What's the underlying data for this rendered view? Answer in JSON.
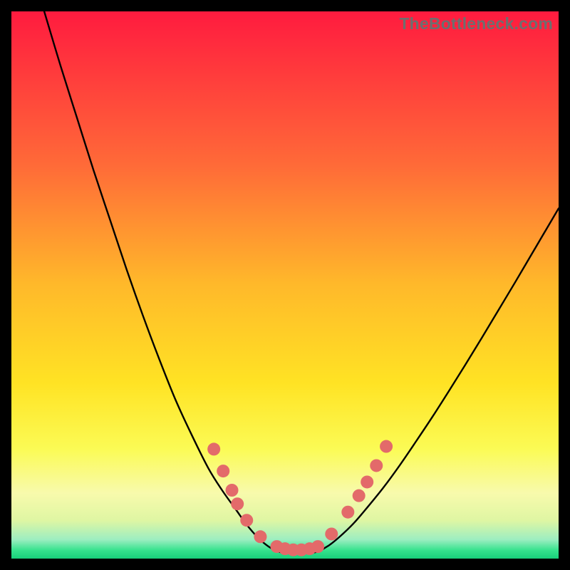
{
  "watermark": "TheBottleneck.com",
  "colors": {
    "page_bg": "#000000",
    "curve": "#000000",
    "dot_fill": "#e36a6a",
    "dot_stroke": "#c94f4f",
    "gradient_stops": [
      {
        "offset": 0.0,
        "color": "#ff1b3f"
      },
      {
        "offset": 0.28,
        "color": "#ff6a38"
      },
      {
        "offset": 0.5,
        "color": "#ffb92a"
      },
      {
        "offset": 0.68,
        "color": "#ffe324"
      },
      {
        "offset": 0.8,
        "color": "#fbfb55"
      },
      {
        "offset": 0.88,
        "color": "#f8faac"
      },
      {
        "offset": 0.93,
        "color": "#dff6a3"
      },
      {
        "offset": 0.965,
        "color": "#9deec1"
      },
      {
        "offset": 0.985,
        "color": "#35e28d"
      },
      {
        "offset": 1.0,
        "color": "#18cf7a"
      }
    ]
  },
  "chart_data": {
    "type": "line",
    "title": "",
    "xlabel": "",
    "ylabel": "",
    "xlim": [
      0,
      100
    ],
    "ylim": [
      0,
      100
    ],
    "series": [
      {
        "name": "left-branch",
        "x": [
          6,
          9,
          12,
          15,
          18,
          21,
          24,
          27,
          30,
          33,
          36,
          38.5,
          41,
          43,
          45,
          47,
          49
        ],
        "y": [
          100,
          90,
          80.5,
          71,
          62,
          53,
          44.5,
          36.5,
          29,
          22.5,
          16.5,
          12.5,
          9,
          6.2,
          3.9,
          2.2,
          1.2
        ]
      },
      {
        "name": "valley-floor",
        "x": [
          49,
          51,
          53,
          55,
          56
        ],
        "y": [
          1.2,
          1.0,
          1.0,
          1.1,
          1.3
        ]
      },
      {
        "name": "right-branch",
        "x": [
          56,
          58,
          60,
          62.5,
          65,
          68,
          71,
          74,
          77,
          80,
          83,
          86,
          89,
          92,
          95,
          98,
          100
        ],
        "y": [
          1.3,
          2.4,
          4.0,
          6.4,
          9.3,
          13.0,
          17.1,
          21.5,
          26.0,
          30.7,
          35.5,
          40.4,
          45.4,
          50.4,
          55.5,
          60.6,
          64.0
        ]
      }
    ],
    "markers": [
      {
        "x": 37.0,
        "y": 20.0
      },
      {
        "x": 38.7,
        "y": 16.0
      },
      {
        "x": 40.3,
        "y": 12.5
      },
      {
        "x": 41.3,
        "y": 10.0
      },
      {
        "x": 43.0,
        "y": 7.0
      },
      {
        "x": 45.5,
        "y": 4.0
      },
      {
        "x": 48.5,
        "y": 2.2
      },
      {
        "x": 50.0,
        "y": 1.8
      },
      {
        "x": 51.5,
        "y": 1.6
      },
      {
        "x": 53.0,
        "y": 1.6
      },
      {
        "x": 54.5,
        "y": 1.8
      },
      {
        "x": 56.0,
        "y": 2.2
      },
      {
        "x": 58.5,
        "y": 4.5
      },
      {
        "x": 61.5,
        "y": 8.5
      },
      {
        "x": 63.5,
        "y": 11.5
      },
      {
        "x": 65.0,
        "y": 14.0
      },
      {
        "x": 66.7,
        "y": 17.0
      },
      {
        "x": 68.5,
        "y": 20.5
      }
    ]
  }
}
